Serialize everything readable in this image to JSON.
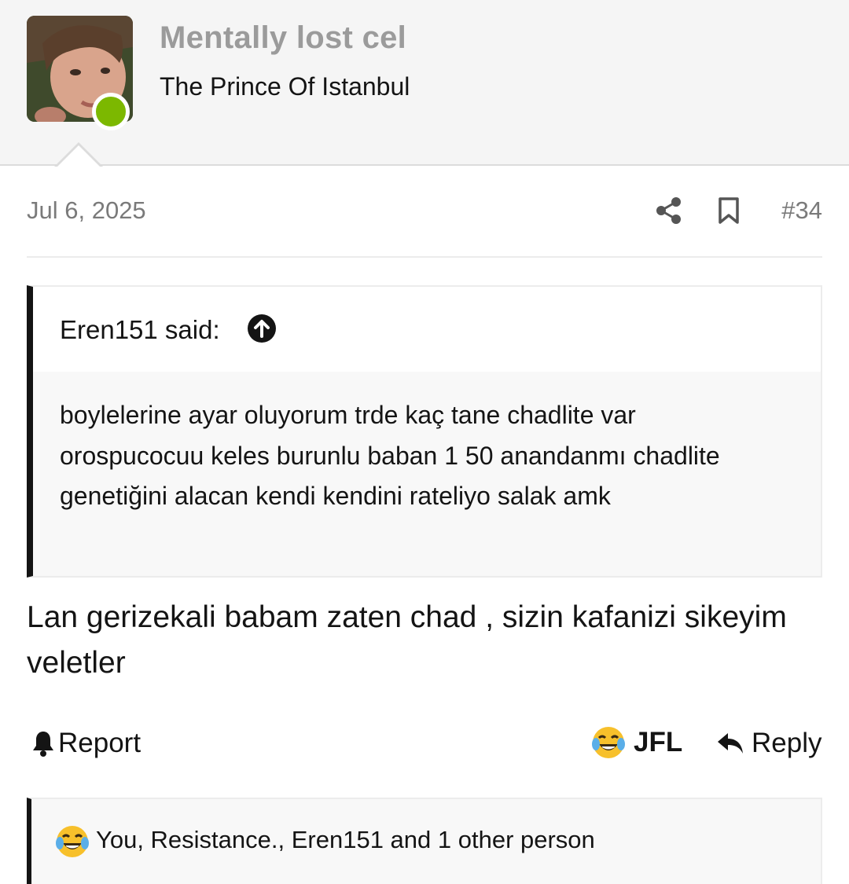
{
  "user": {
    "name": "Mentally lost cel",
    "title": "The Prince Of Istanbul",
    "online_color": "#7cb800"
  },
  "post": {
    "date": "Jul 6, 2025",
    "number": "#34",
    "icons": [
      "share-icon",
      "bookmark-icon"
    ],
    "quote": {
      "author": "Eren151 said:",
      "icon": "arrow-up-circle-icon",
      "text": "boylelerine ayar oluyorum trde kaç tane chadlite var orospucocuu keles burunlu baban 1 50 anandanmı chadlite genetiğini alacan kendi kendini rateliyo salak amk"
    },
    "body": "Lan gerizekali babam zaten chad , sizin kafanizi sikeyim veletler"
  },
  "actions": {
    "report_label": "Report",
    "jfl_label": "JFL",
    "reply_label": "Reply"
  },
  "reactions": {
    "emoji": "laughing-crying-emoji-icon",
    "text": "You, Resistance., Eren151 and 1 other person"
  }
}
